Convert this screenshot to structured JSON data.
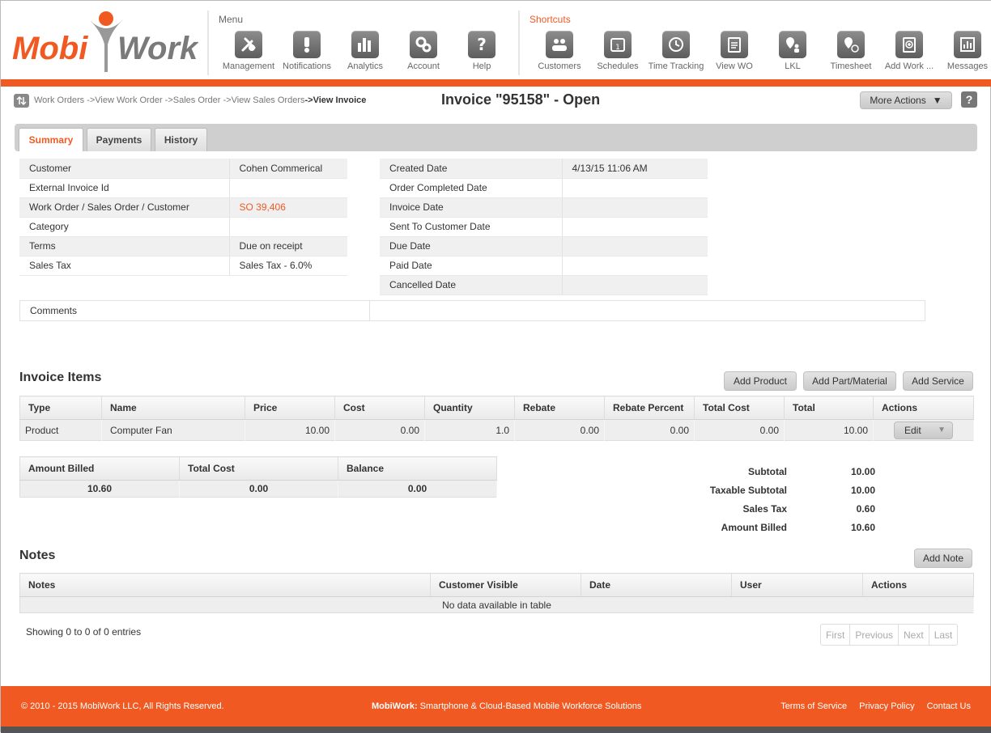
{
  "brand": {
    "logo_left": "Mobi",
    "logo_right": "Work"
  },
  "menu": {
    "title": "Menu",
    "items": [
      {
        "label": "Management",
        "icon": "wrench-screwdriver-icon"
      },
      {
        "label": "Notifications",
        "icon": "exclamation-icon"
      },
      {
        "label": "Analytics",
        "icon": "bar-chart-icon"
      },
      {
        "label": "Account",
        "icon": "gears-icon"
      },
      {
        "label": "Help",
        "icon": "question-icon"
      }
    ]
  },
  "shortcuts": {
    "title": "Shortcuts",
    "items": [
      {
        "label": "Customers",
        "icon": "people-icon"
      },
      {
        "label": "Schedules",
        "icon": "calendar-icon"
      },
      {
        "label": "Time Tracking",
        "icon": "clock-icon"
      },
      {
        "label": "View WO",
        "icon": "clipboard-list-icon"
      },
      {
        "label": "LKL",
        "icon": "map-pin-person-icon"
      },
      {
        "label": "Timesheet",
        "icon": "pin-clock-icon"
      },
      {
        "label": "Add Work ...",
        "icon": "clipboard-plus-icon"
      },
      {
        "label": "Messages",
        "icon": "chart-doc-icon"
      }
    ]
  },
  "breadcrumb": {
    "path": "Work Orders ->View Work Order ->Sales Order ->View Sales Orders ",
    "current": "->View Invoice"
  },
  "page": {
    "title": "Invoice \"95158\" - Open",
    "more_actions": "More Actions",
    "help": "?"
  },
  "tabs": [
    "Summary",
    "Payments",
    "History"
  ],
  "summary_left": [
    {
      "label": "Customer",
      "value": "Cohen Commerical",
      "link": false
    },
    {
      "label": "External Invoice Id",
      "value": "",
      "link": false
    },
    {
      "label": "Work Order / Sales Order / Customer",
      "value": "SO 39,406",
      "link": true
    },
    {
      "label": "Category",
      "value": "",
      "link": false
    },
    {
      "label": "Terms",
      "value": "Due on receipt",
      "link": false
    },
    {
      "label": "Sales Tax",
      "value": "Sales Tax - 6.0%",
      "link": false
    }
  ],
  "summary_right": [
    {
      "label": "Created Date",
      "value": "4/13/15 11:06 AM"
    },
    {
      "label": "Order Completed Date",
      "value": ""
    },
    {
      "label": "Invoice Date",
      "value": ""
    },
    {
      "label": "Sent To Customer Date",
      "value": ""
    },
    {
      "label": "Due Date",
      "value": ""
    },
    {
      "label": "Paid Date",
      "value": ""
    },
    {
      "label": "Cancelled Date",
      "value": ""
    }
  ],
  "comments": {
    "label": "Comments",
    "value": ""
  },
  "invoice_items": {
    "title": "Invoice Items",
    "buttons": {
      "add_product": "Add Product",
      "add_part": "Add Part/Material",
      "add_service": "Add Service"
    },
    "columns": [
      "Type",
      "Name",
      "Price",
      "Cost",
      "Quantity",
      "Rebate",
      "Rebate Percent",
      "Total Cost",
      "Total",
      "Actions"
    ],
    "rows": [
      {
        "type": "Product",
        "name": "Computer Fan",
        "price": "10.00",
        "cost": "0.00",
        "quantity": "1.0",
        "rebate": "0.00",
        "rebate_percent": "0.00",
        "total_cost": "0.00",
        "total": "10.00",
        "action": "Edit"
      }
    ]
  },
  "billing": {
    "columns": [
      "Amount Billed",
      "Total Cost",
      "Balance"
    ],
    "values": [
      "10.60",
      "0.00",
      "0.00"
    ]
  },
  "totals": [
    {
      "label": "Subtotal",
      "value": "10.00"
    },
    {
      "label": "Taxable Subtotal",
      "value": "10.00"
    },
    {
      "label": "Sales Tax",
      "value": "0.60"
    },
    {
      "label": "Amount Billed",
      "value": "10.60"
    }
  ],
  "notes": {
    "title": "Notes",
    "add_button": "Add Note",
    "columns": [
      "Notes",
      "Customer Visible",
      "Date",
      "User",
      "Actions"
    ],
    "empty": "No data available in table",
    "showing": "Showing 0 to 0 of 0 entries",
    "pager": [
      "First",
      "Previous",
      "Next",
      "Last"
    ]
  },
  "footer": {
    "copyright": "© 2010 - 2015 MobiWork LLC, All Rights Reserved.",
    "tag_bold": "MobiWork:",
    "tag_rest": " Smartphone & Cloud-Based Mobile Workforce Solutions",
    "links": [
      "Terms of Service",
      "Privacy Policy",
      "Contact Us"
    ]
  },
  "colors": {
    "accent": "#f05a22",
    "icon_gray": "#6e6e6e"
  }
}
